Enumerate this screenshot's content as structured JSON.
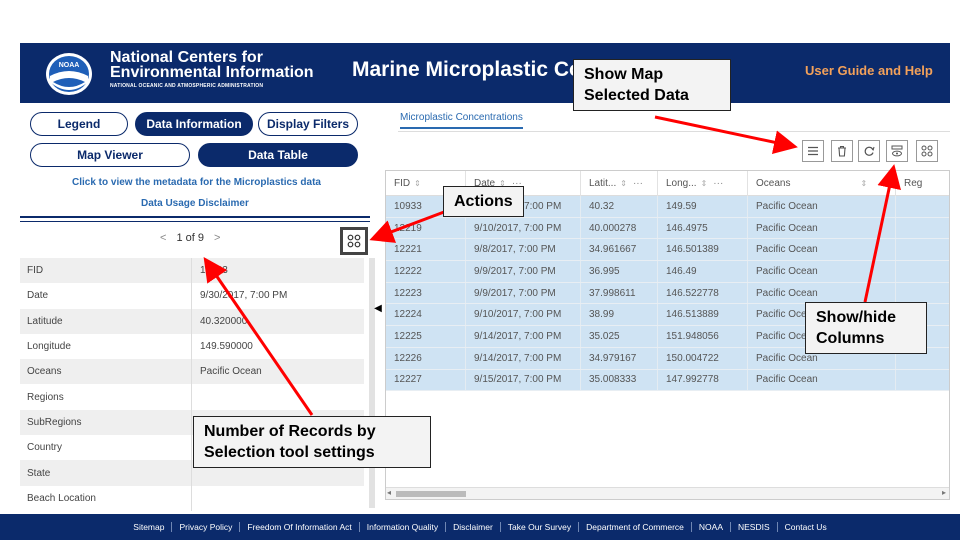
{
  "header": {
    "org_line1": "National Centers for",
    "org_line2": "Environmental Information",
    "org_line3": "NATIONAL OCEANIC AND ATMOSPHERIC ADMINISTRATION",
    "logo_text": "NOAA",
    "app_title": "Marine Microplastic Co",
    "guide_link": "User Guide and Help"
  },
  "left_panel": {
    "buttons": {
      "legend": "Legend",
      "data_information": "Data Information",
      "display_filters": "Display Filters",
      "map_viewer": "Map Viewer",
      "data_table": "Data Table"
    },
    "metadata_link": "Click to view the metadata for the Microplastics data",
    "disclaimer_link": "Data Usage Disclaimer",
    "pager": {
      "prev": "<",
      "text": "1 of 9",
      "next": ">"
    },
    "attributes": [
      {
        "key": "FID",
        "value": "10933"
      },
      {
        "key": "Date",
        "value": "9/30/2017, 7:00 PM"
      },
      {
        "key": "Latitude",
        "value": "40.320000"
      },
      {
        "key": "Longitude",
        "value": "149.590000"
      },
      {
        "key": "Oceans",
        "value": "Pacific Ocean"
      },
      {
        "key": "Regions",
        "value": ""
      },
      {
        "key": "SubRegions",
        "value": ""
      },
      {
        "key": "Country",
        "value": ""
      },
      {
        "key": "State",
        "value": ""
      },
      {
        "key": "Beach Location",
        "value": ""
      }
    ]
  },
  "right_panel": {
    "tab": "Microplastic Concentrations",
    "toolbar_icons": [
      "list-icon",
      "trash-icon",
      "refresh-icon",
      "show-hide-columns-icon",
      "grid-options-icon"
    ],
    "columns": [
      "FID",
      "Date",
      "Latit...",
      "Long...",
      "Oceans",
      "Reg"
    ],
    "rows": [
      [
        "10933",
        "9/30/2017, 7:00 PM",
        "40.32",
        "149.59",
        "Pacific Ocean"
      ],
      [
        "12219",
        "9/10/2017, 7:00 PM",
        "40.000278",
        "146.4975",
        "Pacific Ocean"
      ],
      [
        "12221",
        "9/8/2017, 7:00 PM",
        "34.961667",
        "146.501389",
        "Pacific Ocean"
      ],
      [
        "12222",
        "9/9/2017, 7:00 PM",
        "36.995",
        "146.49",
        "Pacific Ocean"
      ],
      [
        "12223",
        "9/9/2017, 7:00 PM",
        "37.998611",
        "146.522778",
        "Pacific Ocean"
      ],
      [
        "12224",
        "9/10/2017, 7:00 PM",
        "38.99",
        "146.513889",
        "Pacific Ocean"
      ],
      [
        "12225",
        "9/14/2017, 7:00 PM",
        "35.025",
        "151.948056",
        "Pacific Ocean"
      ],
      [
        "12226",
        "9/14/2017, 7:00 PM",
        "34.979167",
        "150.004722",
        "Pacific Ocean"
      ],
      [
        "12227",
        "9/15/2017, 7:00 PM",
        "35.008333",
        "147.992778",
        "Pacific Ocean"
      ]
    ]
  },
  "footer": {
    "links": [
      "Sitemap",
      "Privacy Policy",
      "Freedom Of Information Act",
      "Information Quality",
      "Disclaimer",
      "Take Our Survey",
      "Department of Commerce",
      "NOAA",
      "NESDIS",
      "Contact Us"
    ]
  },
  "annotations": {
    "show_map": "Show Map Selected Data",
    "actions": "Actions",
    "show_hide": "Show/hide Columns",
    "records": "Number of Records by Selection tool settings"
  },
  "colors": {
    "navy": "#0b2a6b",
    "orange_link": "#f3a15a",
    "selected_row": "#cfe3f3",
    "arrow": "#ff0000"
  }
}
